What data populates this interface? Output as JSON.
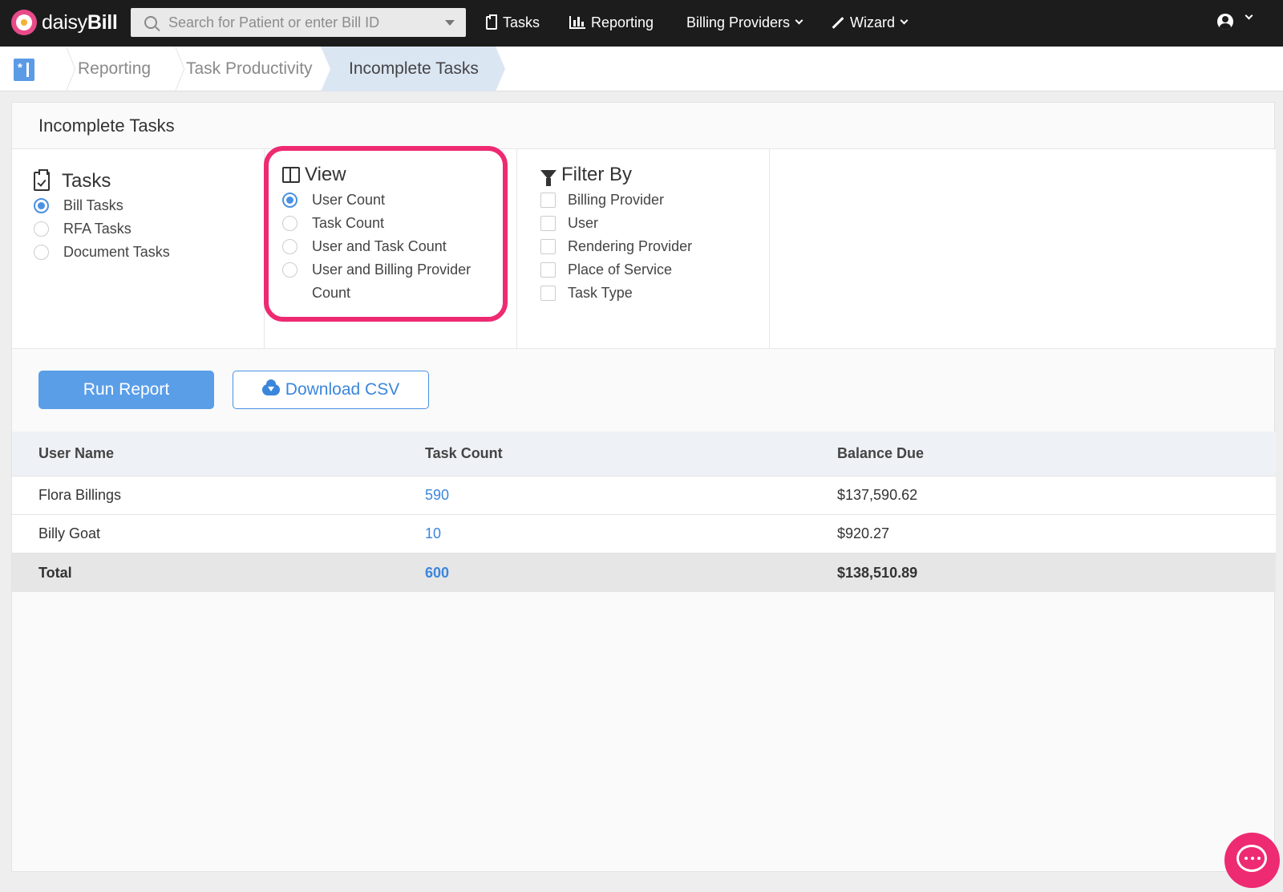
{
  "app": {
    "logo_light": "daisy",
    "logo_bold": "Bill"
  },
  "search": {
    "placeholder": "Search for Patient or enter Bill ID"
  },
  "nav": {
    "tasks": "Tasks",
    "reporting": "Reporting",
    "billing_providers": "Billing Providers",
    "wizard": "Wizard"
  },
  "breadcrumb": {
    "items": [
      "Reporting",
      "Task Productivity"
    ],
    "active": "Incomplete Tasks"
  },
  "panel": {
    "title": "Incomplete Tasks"
  },
  "tasks_group": {
    "title": "Tasks",
    "options": [
      {
        "label": "Bill Tasks",
        "selected": true
      },
      {
        "label": "RFA Tasks",
        "selected": false
      },
      {
        "label": "Document Tasks",
        "selected": false
      }
    ]
  },
  "view_group": {
    "title": "View",
    "options": [
      {
        "label": "User Count",
        "selected": true
      },
      {
        "label": "Task Count",
        "selected": false
      },
      {
        "label": "User and Task Count",
        "selected": false
      },
      {
        "label": "User and Billing Provider Count",
        "selected": false
      }
    ]
  },
  "filter_group": {
    "title": "Filter By",
    "options": [
      {
        "label": "Billing Provider",
        "checked": false
      },
      {
        "label": "User",
        "checked": false
      },
      {
        "label": "Rendering Provider",
        "checked": false
      },
      {
        "label": "Place of Service",
        "checked": false
      },
      {
        "label": "Task Type",
        "checked": false
      }
    ]
  },
  "actions": {
    "run": "Run Report",
    "csv": "Download CSV"
  },
  "table": {
    "headers": [
      "User Name",
      "Task Count",
      "Balance Due"
    ],
    "rows": [
      {
        "user": "Flora Billings",
        "count": "590",
        "balance": "$137,590.62"
      },
      {
        "user": "Billy Goat",
        "count": "10",
        "balance": "$920.27"
      }
    ],
    "total": {
      "label": "Total",
      "count": "600",
      "balance": "$138,510.89"
    }
  },
  "colors": {
    "accent": "#4a90e2",
    "highlight": "#ee2a72",
    "nav_bg": "#1c1c1c"
  }
}
